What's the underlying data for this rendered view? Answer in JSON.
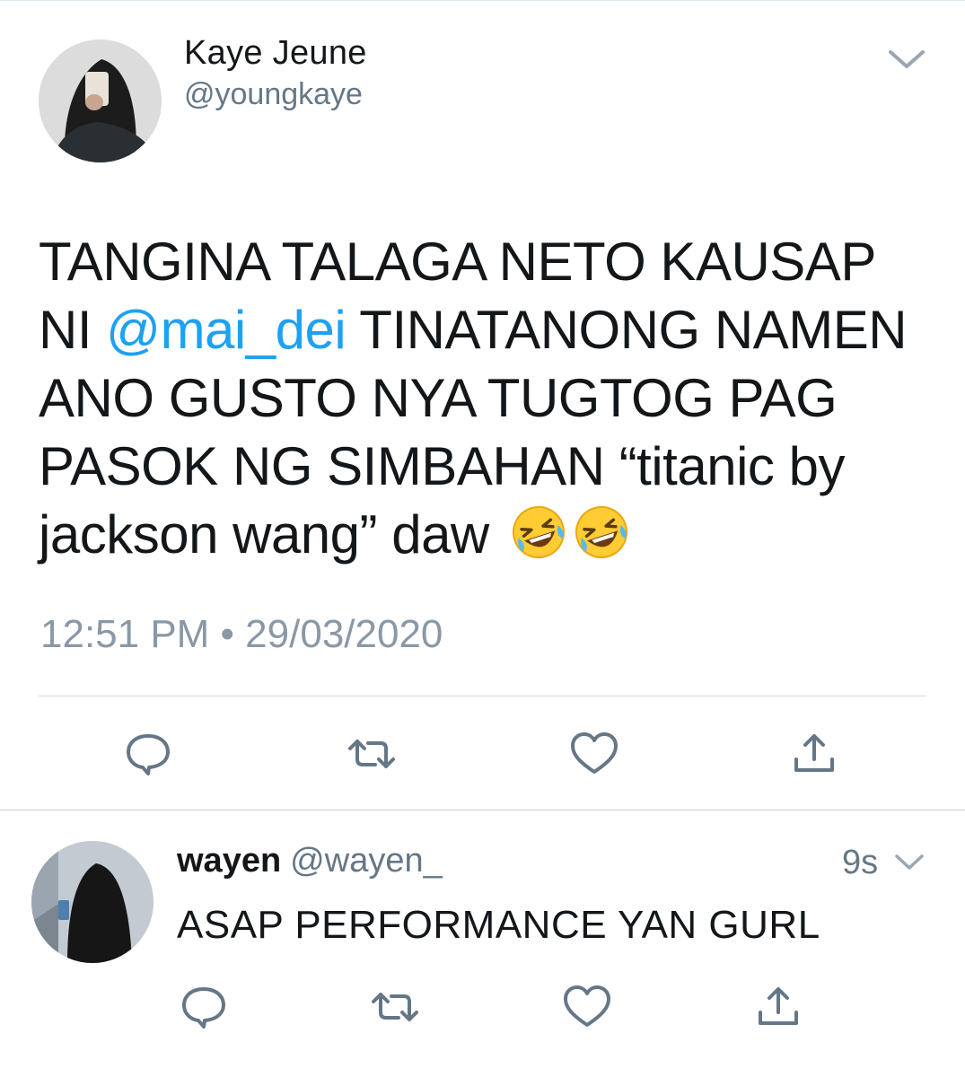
{
  "tweet": {
    "author_name": "Kaye Jeune",
    "author_handle": "@youngkaye",
    "text_part1": "TANGINA TALAGA NETO KAUSAP NI ",
    "mention": "@mai_dei",
    "text_part2": " TINATANONG NAMEN ANO GUSTO NYA TUGTOG PAG PASOK NG SIMBAHAN “titanic by jackson wang” daw",
    "emoji_icon": "rolling-on-floor-laughing-emoji",
    "emoji_count": 2,
    "timestamp": "12:51 PM • 29/03/2020",
    "actions": [
      "reply-icon",
      "retweet-icon",
      "like-icon",
      "share-icon"
    ]
  },
  "reply": {
    "author_name": "wayen",
    "author_handle": "@wayen_",
    "time": "9s",
    "text": "ASAP PERFORMANCE YAN GURL",
    "actions": [
      "reply-icon",
      "retweet-icon",
      "like-icon",
      "share-icon"
    ]
  },
  "colors": {
    "link": "#1da1f2",
    "secondary_text": "#657786",
    "icon": "#657786",
    "divider": "#cfd6dc"
  }
}
